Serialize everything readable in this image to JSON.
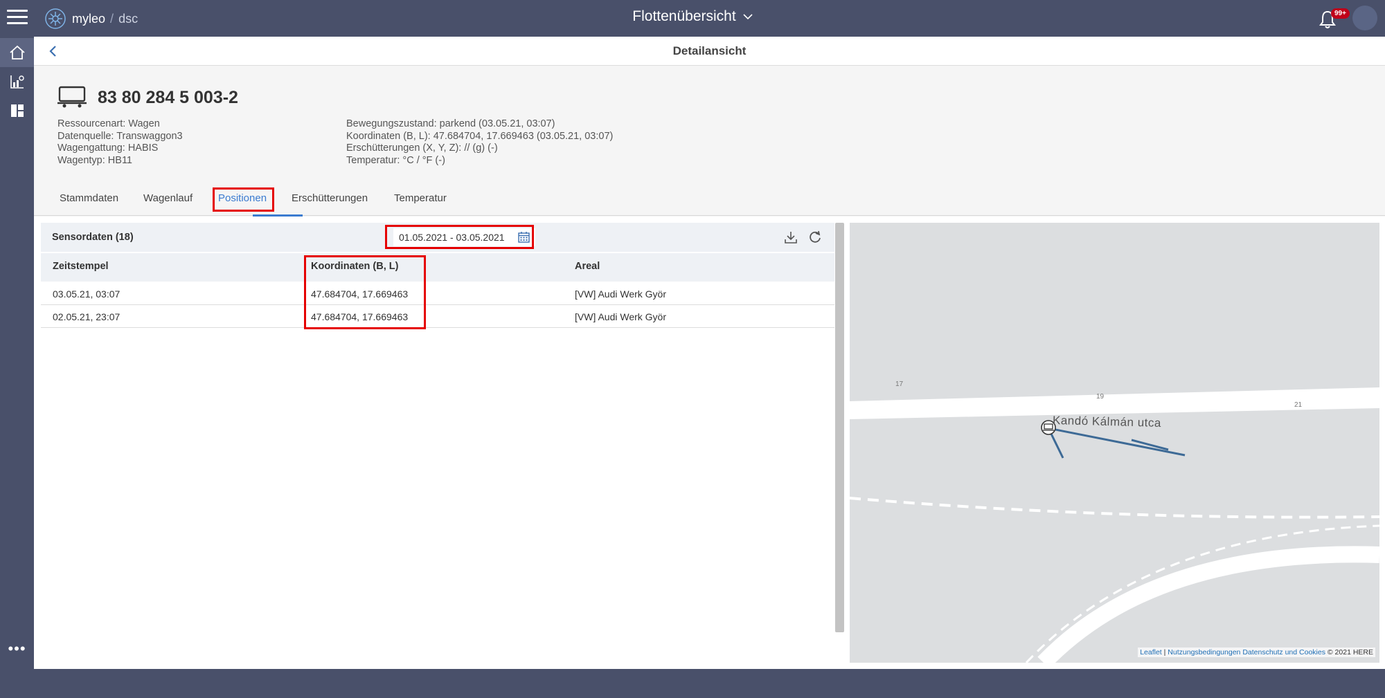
{
  "app": {
    "logo_name": "myleo",
    "logo_slash": "/",
    "logo_suffix": "dsc",
    "page_switch_label": "Flottenübersicht",
    "notifications_badge": "99+"
  },
  "subheader": {
    "title": "Detailansicht"
  },
  "resource": {
    "title": "83 80 284 5 003-2",
    "meta_left": [
      "Ressourcenart: Wagen",
      "Datenquelle: Transwaggon3",
      "Wagengattung: HABIS",
      "Wagentyp: HB11"
    ],
    "meta_right": [
      "Bewegungszustand: parkend (03.05.21, 03:07)",
      "Koordinaten (B, L): 47.684704, 17.669463 (03.05.21, 03:07)",
      "Erschütterungen (X, Y, Z): // (g) (-)",
      "Temperatur: °C / °F (-)"
    ]
  },
  "tabs": [
    {
      "label": "Stammdaten"
    },
    {
      "label": "Wagenlauf"
    },
    {
      "label": "Positionen"
    },
    {
      "label": "Erschütterungen"
    },
    {
      "label": "Temperatur"
    }
  ],
  "active_tab": "Positionen",
  "sensor": {
    "title": "Sensordaten (18)",
    "date_range": "01.05.2021 - 03.05.2021"
  },
  "table": {
    "columns": [
      "Zeitstempel",
      "Koordinaten (B, L)",
      "Areal"
    ],
    "rows": [
      [
        "03.05.21, 03:07",
        "47.684704, 17.669463",
        "[VW] Audi Werk Györ"
      ],
      [
        "02.05.21, 23:07",
        "47.684704, 17.669463",
        "[VW] Audi Werk Györ"
      ]
    ]
  },
  "map": {
    "street_label": "Kandó Kálmán utca",
    "house_numbers": [
      "17",
      "19",
      "21"
    ],
    "attribution_leaflet": "Leaflet",
    "attribution_sep": "|",
    "attribution_terms": "Nutzungsbedingungen",
    "attribution_privacy": "Datenschutz und Cookies",
    "attribution_copyright": "© 2021 HERE"
  },
  "colors": {
    "topbar": "#49506a",
    "accent": "#3b7bd0",
    "highlight": "#e50000",
    "track": "#3d6a96"
  },
  "icons": {
    "menu": "hamburger-icon",
    "notifications": "bell-icon",
    "back": "chevron-left-icon",
    "calendar": "calendar-icon",
    "download": "download-icon",
    "refresh": "refresh-icon"
  }
}
